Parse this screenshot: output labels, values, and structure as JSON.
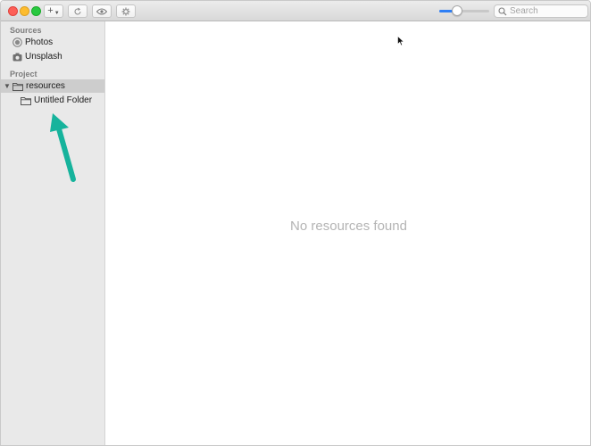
{
  "toolbar": {
    "add_label": "+",
    "search": {
      "placeholder": "Search",
      "value": ""
    },
    "zoom_level": 0.36
  },
  "sidebar": {
    "sources_header": "Sources",
    "sources": [
      {
        "label": "Photos",
        "icon": "photos-icon"
      },
      {
        "label": "Unsplash",
        "icon": "camera-icon"
      }
    ],
    "project_header": "Project",
    "project": [
      {
        "label": "resources",
        "icon": "folder-icon",
        "expanded": true,
        "selected": true
      },
      {
        "label": "Untitled Folder",
        "icon": "folder-icon",
        "level": 1
      }
    ]
  },
  "main": {
    "empty_message": "No resources found"
  },
  "colors": {
    "accent": "#2f7ff5",
    "annotation": "#16b39c"
  }
}
